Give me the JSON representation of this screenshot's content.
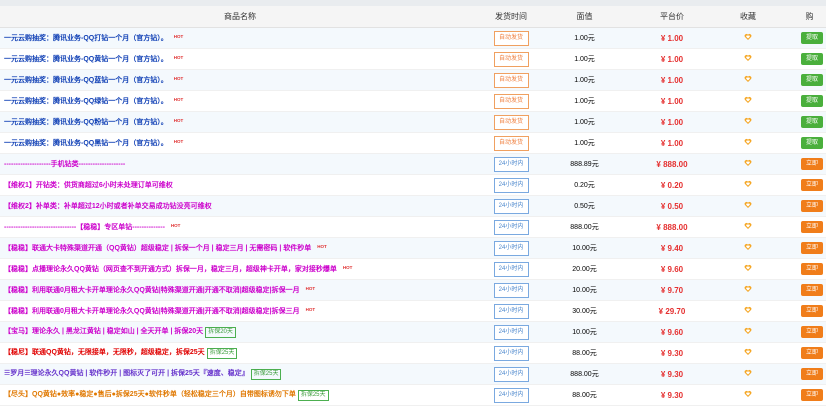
{
  "headers": {
    "name": "商品名称",
    "deliver": "发货时间",
    "face": "面值",
    "price": "平台价",
    "fav": "收藏",
    "buy": "购"
  },
  "colors": {
    "blue": "#0f3fb5",
    "purple": "#cc00cc",
    "red": "#e53030",
    "accent_orange": "#f07d1a",
    "accent_green": "#4aaf3c"
  },
  "rows": [
    {
      "name": "一元云购抽奖：腾讯业务-QQ打钻一个月（官方钻）。",
      "hot": "HOT",
      "badge": "",
      "deliver": "自动发货",
      "face": "1.00元",
      "price": "¥ 1.00",
      "fav_icon": "heart-icon",
      "buy": "提取"
    },
    {
      "name": "一元云购抽奖：腾讯业务-QQ黄钻一个月（官方钻）。",
      "hot": "HOT",
      "badge": "",
      "deliver": "自动发货",
      "face": "1.00元",
      "price": "¥ 1.00",
      "fav_icon": "heart-icon",
      "buy": "提取"
    },
    {
      "name": "一元云购抽奖：腾讯业务-QQ蓝钻一个月（官方钻）。",
      "hot": "HOT",
      "badge": "",
      "deliver": "自动发货",
      "face": "1.00元",
      "price": "¥ 1.00",
      "fav_icon": "heart-icon",
      "buy": "提取"
    },
    {
      "name": "一元云购抽奖：腾讯业务-QQ绿钻一个月（官方钻）。",
      "hot": "HOT",
      "badge": "",
      "deliver": "自动发货",
      "face": "1.00元",
      "price": "¥ 1.00",
      "fav_icon": "heart-icon",
      "buy": "提取"
    },
    {
      "name": "一元云购抽奖：腾讯业务-QQ粉钻一个月（官方钻）。",
      "hot": "HOT",
      "badge": "",
      "deliver": "自动发货",
      "face": "1.00元",
      "price": "¥ 1.00",
      "fav_icon": "heart-icon",
      "buy": "提取"
    },
    {
      "name": "一元云购抽奖：腾讯业务-QQ黑钻一个月（官方钻）。",
      "hot": "HOT",
      "badge": "",
      "deliver": "自动发货",
      "face": "1.00元",
      "price": "¥ 1.00",
      "fav_icon": "heart-icon",
      "buy": "提取"
    },
    {
      "name": "--------------------手机钻类--------------------",
      "hot": "",
      "badge": "",
      "deliver": "24小时内",
      "face": "888.89元",
      "price": "¥ 888.00",
      "fav_icon": "heart-icon",
      "buy": "立即"
    },
    {
      "name": "【维权1】开钻类：供货商超过6小时未处理订单可维权",
      "hot": "",
      "badge": "",
      "deliver": "24小时内",
      "face": "0.20元",
      "price": "¥ 0.20",
      "fav_icon": "heart-icon",
      "buy": "立即"
    },
    {
      "name": "【维权2】补单类：补单超过12小时或者补单交易成功钻没亮可维权",
      "hot": "",
      "badge": "",
      "deliver": "24小时内",
      "face": "0.50元",
      "price": "¥ 0.50",
      "fav_icon": "heart-icon",
      "buy": "立即"
    },
    {
      "name": "-------------------------------【稳稳】专区单钻--------------",
      "hot": "HOT",
      "badge": "",
      "deliver": "24小时内",
      "face": "888.00元",
      "price": "¥ 888.00",
      "fav_icon": "heart-icon",
      "buy": "立即"
    },
    {
      "name": "【稳稳】联通大卡特殊渠道开通（QQ黄钻）超级稳定 | 拆保一个月 | 稳定三月 | 无需密码 | 软件秒单",
      "hot": "HOT",
      "badge": "",
      "deliver": "24小时内",
      "face": "10.00元",
      "price": "¥ 9.40",
      "fav_icon": "heart-icon",
      "buy": "立即"
    },
    {
      "name": "【稳稳】点播理论永久QQ黄钻（网页查不到开通方式）拆保一月，稳定三月，超级神卡开单，家对接秒爆单",
      "hot": "HOT",
      "badge": "",
      "deliver": "24小时内",
      "face": "20.00元",
      "price": "¥ 9.60",
      "fav_icon": "heart-icon",
      "buy": "立即"
    },
    {
      "name": "【稳稳】利用联通0月租大卡开单理论永久QQ黄钻|特殊渠道开通|开通不取消|超级稳定|拆保一月",
      "hot": "HOT",
      "badge": "",
      "deliver": "24小时内",
      "face": "10.00元",
      "price": "¥ 9.70",
      "fav_icon": "heart-icon",
      "buy": "立即"
    },
    {
      "name": "【稳稳】利用联通0月租大卡开单理论永久QQ黄钻|特殊渠道开通|开通不取消|超级稳定|拆保三月",
      "hot": "HOT",
      "badge": "",
      "deliver": "24小时内",
      "face": "30.00元",
      "price": "¥ 29.70",
      "fav_icon": "heart-icon",
      "buy": "立即"
    },
    {
      "name": "【宝马】理论永久 | 黑龙江黄钻 | 稳定如山 | 全天开单 | 拆保20天",
      "hot": "",
      "badge": "拆保20天",
      "deliver": "24小时内",
      "face": "10.00元",
      "price": "¥ 9.60",
      "fav_icon": "heart-icon",
      "buy": "立即"
    },
    {
      "name": "【稳尼】联通QQ黄钻，无限接单，无限秒，超级稳定，拆保25天",
      "hot": "",
      "badge": "拆保25天",
      "deliver": "24小时内",
      "face": "88.00元",
      "price": "¥ 9.30",
      "fav_icon": "heart-icon",
      "buy": "立即"
    },
    {
      "name": "☰罗月☰理论永久QQ黄钻 | 软件秒开 | 图标灭了可开 | 拆保25天『速度、稳定』",
      "hot": "",
      "badge": "拆保25天",
      "deliver": "24小时内",
      "face": "888.00元",
      "price": "¥ 9.30",
      "fav_icon": "heart-icon",
      "buy": "立即"
    },
    {
      "name": "【尽头】QQ黄钻●效率●稳定●售后●拆保25天●软件秒单（轻松稳定三个月）自带图标诱勿下单",
      "hot": "",
      "badge": "拆保25天",
      "deliver": "24小时内",
      "face": "88.00元",
      "price": "¥ 9.30",
      "fav_icon": "heart-icon",
      "buy": "立即"
    }
  ]
}
